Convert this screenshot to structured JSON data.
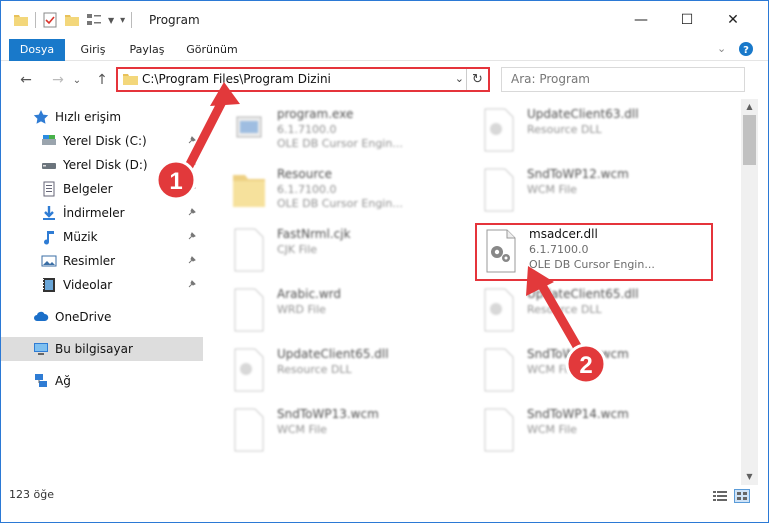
{
  "window": {
    "title": "Program",
    "minimize_glyph": "—",
    "maximize_glyph": "☐",
    "close_glyph": "✕"
  },
  "ribbon": {
    "tabs": [
      {
        "label": "Dosya",
        "active": true
      },
      {
        "label": "Giriş",
        "active": false
      },
      {
        "label": "Paylaş",
        "active": false
      },
      {
        "label": "Görünüm",
        "active": false
      }
    ]
  },
  "nav": {
    "back_glyph": "←",
    "forward_glyph": "→",
    "recent_glyph": "⌄",
    "up_glyph": "↑",
    "address": "C:\\Program Files\\Program Dizini",
    "address_dropdown_glyph": "⌄",
    "refresh_glyph": "↻",
    "search_placeholder": "Ara: Program"
  },
  "sidebar": {
    "items": [
      {
        "label": "Hızlı erişim",
        "icon": "star-icon"
      },
      {
        "label": "Yerel Disk (C:)",
        "icon": "drive-icon"
      },
      {
        "label": "Yerel Disk (D:)",
        "icon": "drive-icon"
      },
      {
        "label": "Belgeler",
        "icon": "documents-icon"
      },
      {
        "label": "İndirmeler",
        "icon": "download-icon"
      },
      {
        "label": "Müzik",
        "icon": "music-icon"
      },
      {
        "label": "Resimler",
        "icon": "pictures-icon"
      },
      {
        "label": "Videolar",
        "icon": "video-icon"
      },
      {
        "label": "OneDrive",
        "icon": "cloud-icon"
      },
      {
        "label": "Bu bilgisayar",
        "icon": "computer-icon"
      },
      {
        "label": "Ağ",
        "icon": "network-icon"
      }
    ]
  },
  "files": [
    {
      "name": "program.exe",
      "line2": "6.1.7100.0",
      "line3": "OLE DB Cursor Engin...",
      "icon": "exe-icon"
    },
    {
      "name": "UpdateClient63.dll",
      "line2": "Resource DLL",
      "line3": "",
      "icon": "dll-icon"
    },
    {
      "name": "Resource",
      "line2": "6.1.7100.0",
      "line3": "OLE DB Cursor Engin...",
      "icon": "folder-icon"
    },
    {
      "name": "SndToWP12.wcm",
      "line2": "WCM File",
      "line3": "",
      "icon": "file-icon"
    },
    {
      "name": "FastNrml.cjk",
      "line2": "CJK File",
      "line3": "",
      "icon": "file-icon"
    },
    {
      "name": "msadcer.dll",
      "line2": "6.1.7100.0",
      "line3": "OLE DB Cursor Engin...",
      "icon": "dll-icon"
    },
    {
      "name": "Arabic.wrd",
      "line2": "WRD File",
      "line3": "",
      "icon": "file-icon"
    },
    {
      "name": "UpdateClient65.dll",
      "line2": "Resource DLL",
      "line3": "",
      "icon": "dll-icon"
    },
    {
      "name": "UpdateClient65.dll",
      "line2": "Resource DLL",
      "line3": "",
      "icon": "dll-icon"
    },
    {
      "name": "SndToWP10.wcm",
      "line2": "WCM File",
      "line3": "",
      "icon": "file-icon"
    },
    {
      "name": "SndToWP13.wcm",
      "line2": "WCM File",
      "line3": "",
      "icon": "file-icon"
    },
    {
      "name": "SndToWP14.wcm",
      "line2": "WCM File",
      "line3": "",
      "icon": "file-icon"
    }
  ],
  "status": {
    "count": "123 öğe"
  },
  "callouts": [
    {
      "label": "1"
    },
    {
      "label": "2"
    }
  ],
  "colors": {
    "accent": "#1979ca",
    "highlight": "#e5343b"
  }
}
